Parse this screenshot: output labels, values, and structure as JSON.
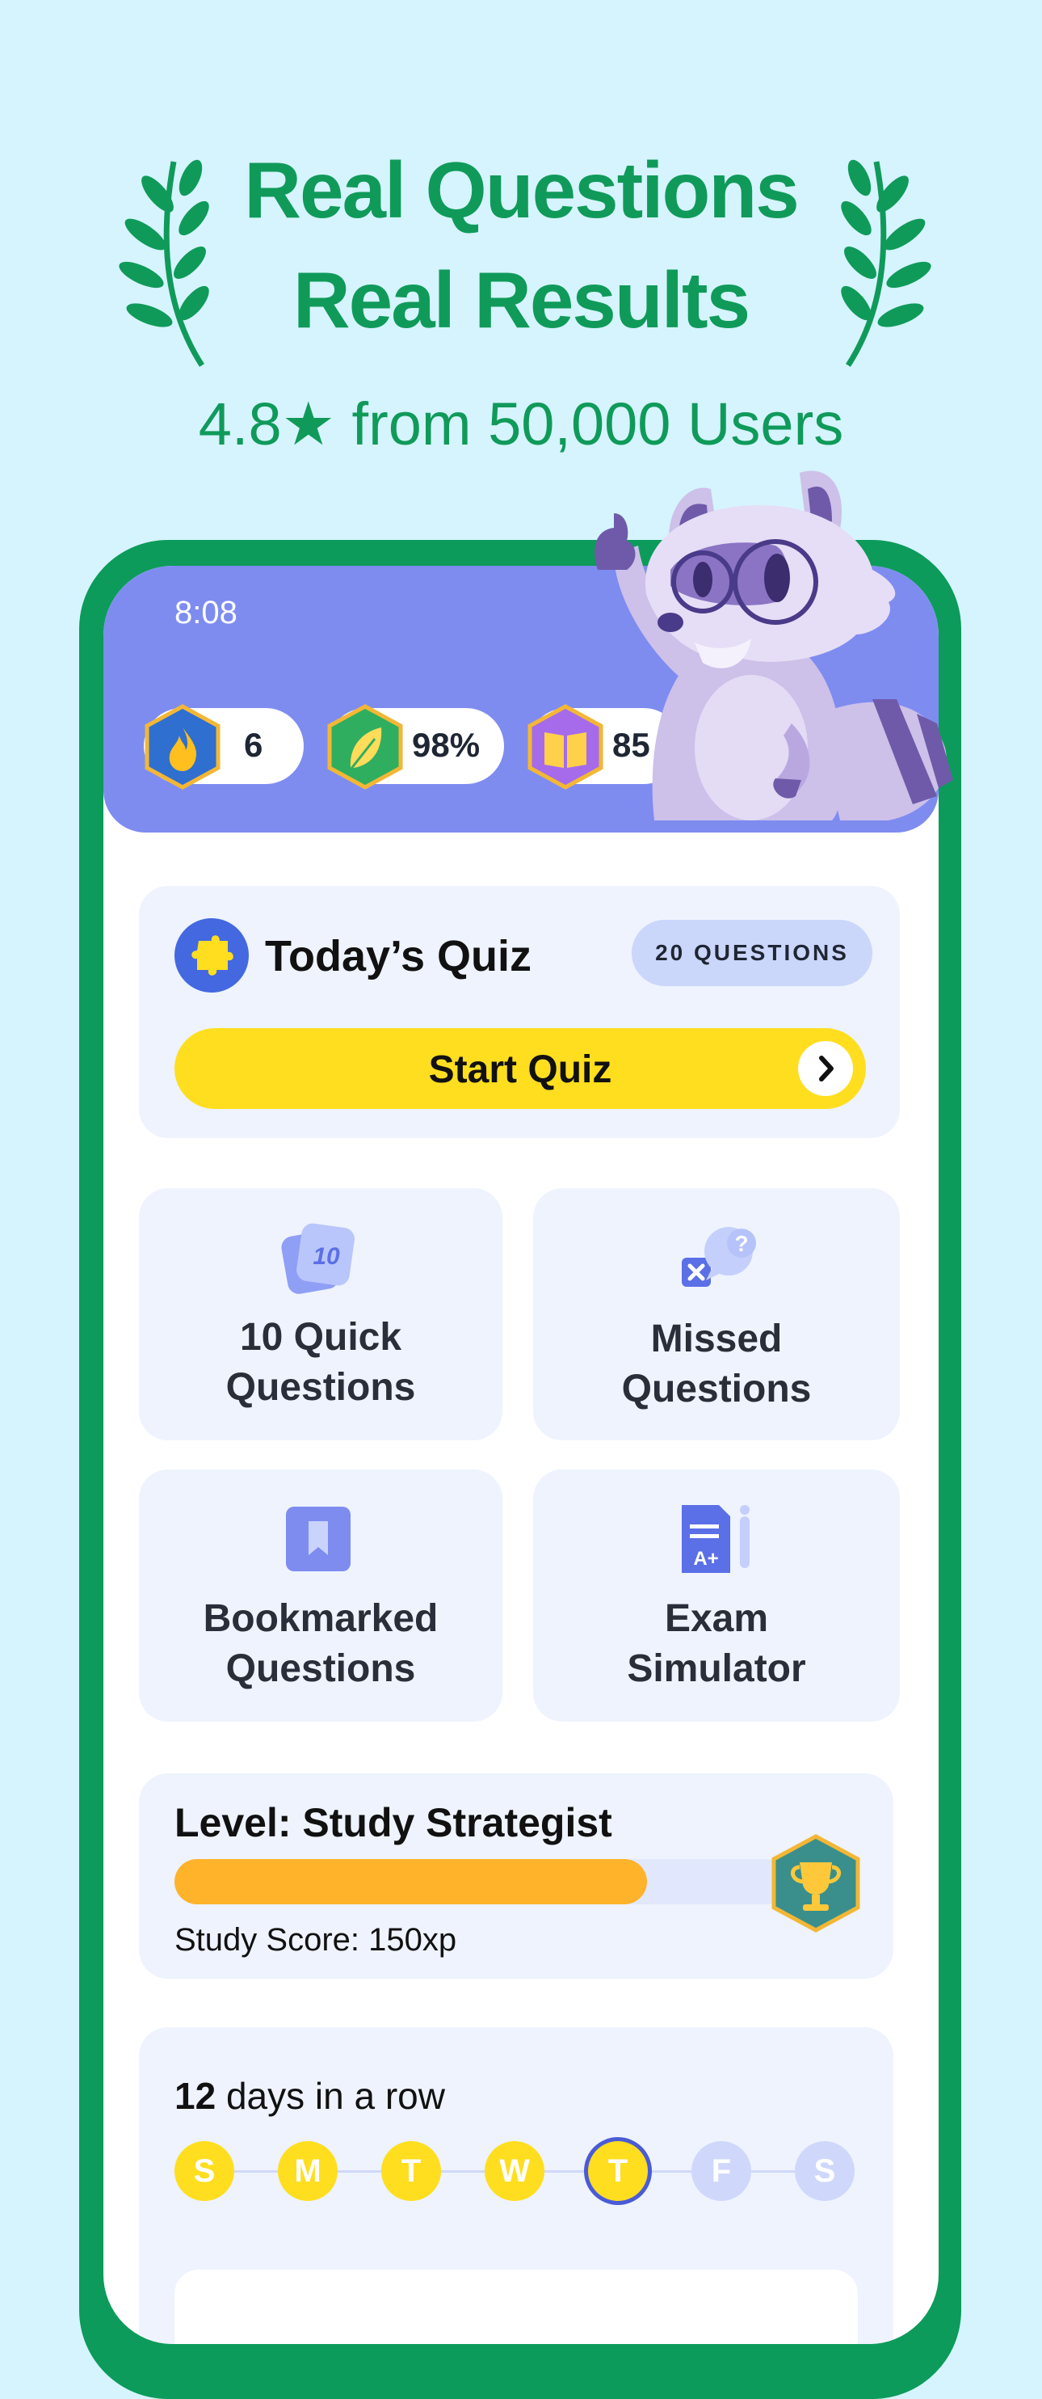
{
  "headline": {
    "line1": "Real Questions",
    "line2": "Real Results"
  },
  "rating": {
    "text": "4.8★ from 50,000 Users"
  },
  "status": {
    "time": "8:08"
  },
  "stats": [
    {
      "icon": "flame-icon",
      "value": "6",
      "color": "#2f6fcf"
    },
    {
      "icon": "leaf-icon",
      "value": "98%",
      "color": "#2fae5f"
    },
    {
      "icon": "book-icon",
      "value": "85",
      "color": "#a56bea"
    }
  ],
  "quiz": {
    "title": "Today’s Quiz",
    "badge": "20 QUESTIONS",
    "button": "Start Quiz"
  },
  "tiles": [
    {
      "icon": "ten-cards-icon",
      "label1": "10 Quick",
      "label2": "Questions",
      "badge": "10"
    },
    {
      "icon": "missed-questions-icon",
      "label1": "Missed",
      "label2": "Questions"
    },
    {
      "icon": "bookmark-icon",
      "label1": "Bookmarked",
      "label2": "Questions"
    },
    {
      "icon": "exam-doc-icon",
      "label1": "Exam",
      "label2": "Simulator"
    }
  ],
  "level": {
    "title": "Level: Study Strategist",
    "score": "Study Score: 150xp",
    "progress": 0.77
  },
  "streak": {
    "count": "12",
    "text": " days in a row",
    "days": [
      {
        "letter": "S",
        "state": "done"
      },
      {
        "letter": "M",
        "state": "done"
      },
      {
        "letter": "T",
        "state": "done"
      },
      {
        "letter": "W",
        "state": "done"
      },
      {
        "letter": "T",
        "state": "today"
      },
      {
        "letter": "F",
        "state": "future"
      },
      {
        "letter": "S",
        "state": "future"
      }
    ]
  },
  "colors": {
    "accent": "#109a5a",
    "header": "#7e8cf0",
    "yellow": "#ffde1f",
    "progress": "#ffb32b"
  }
}
